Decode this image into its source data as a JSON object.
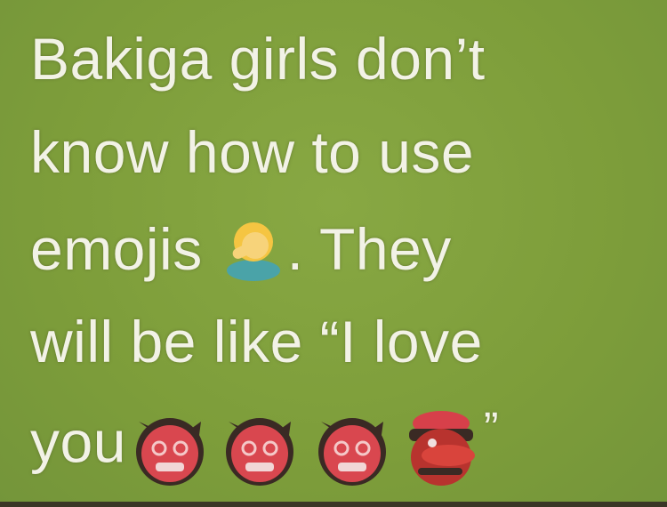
{
  "lines": [
    "Bakiga girls don’t",
    "know how to use",
    "emojis",
    ". They",
    "will be like “I love",
    "you",
    "”"
  ],
  "icons": {
    "facepalm": "woman-facepalming-icon",
    "ogre": "ogre-icon",
    "goblin": "goblin-icon"
  },
  "colors": {
    "background": "#7fa03c",
    "text": "#f2f2e6",
    "emoji_red": "#d0404a"
  }
}
